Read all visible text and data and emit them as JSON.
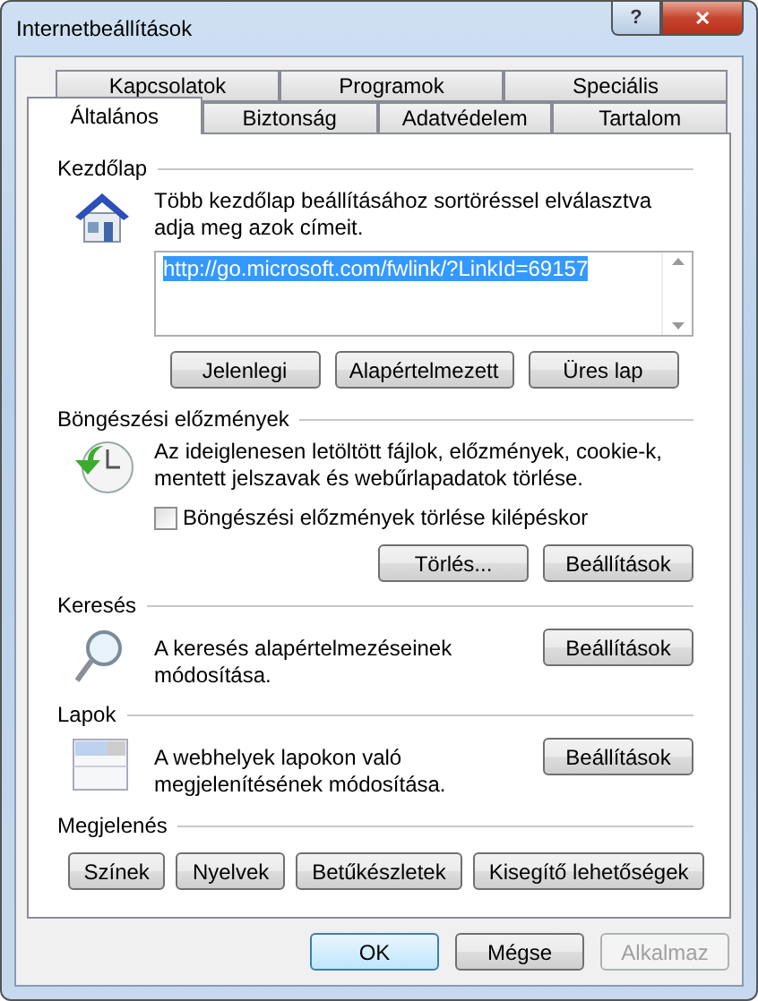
{
  "window": {
    "title": "Internetbeállítások",
    "help": "?",
    "close": "✕"
  },
  "tab_rows": [
    [
      {
        "label": "Kapcsolatok",
        "selected": false
      },
      {
        "label": "Programok",
        "selected": false
      },
      {
        "label": "Speciális",
        "selected": false
      }
    ],
    [
      {
        "label": "Általános",
        "selected": true
      },
      {
        "label": "Biztonság",
        "selected": false
      },
      {
        "label": "Adatvédelem",
        "selected": false
      },
      {
        "label": "Tartalom",
        "selected": false
      }
    ]
  ],
  "home": {
    "title": "Kezdőlap",
    "description": "Több kezdőlap beállításához sortöréssel elválasztva adja meg azok címeit.",
    "url": "http://go.microsoft.com/fwlink/?LinkId=69157",
    "buttons": [
      "Jelenlegi",
      "Alapértelmezett",
      "Üres lap"
    ]
  },
  "history": {
    "title": "Böngészési előzmények",
    "description": "Az ideiglenesen letöltött fájlok, előzmények, cookie-k, mentett jelszavak és webűrlapadatok törlése.",
    "checkbox": {
      "label": "Böngészési előzmények törlése kilépéskor",
      "checked": false
    },
    "buttons": [
      "Törlés...",
      "Beállítások"
    ]
  },
  "search": {
    "title": "Keresés",
    "description": "A keresés alapértelmezéseinek módosítása.",
    "button": "Beállítások"
  },
  "tabs": {
    "title": "Lapok",
    "description": "A webhelyek lapokon való megjelenítésének módosítása.",
    "button": "Beállítások"
  },
  "appearance": {
    "title": "Megjelenés",
    "buttons": [
      "Színek",
      "Nyelvek",
      "Betűkészletek",
      "Kisegítő lehetőségek"
    ]
  },
  "footer": [
    {
      "label": "OK",
      "default": true,
      "disabled": false
    },
    {
      "label": "Mégse",
      "default": false,
      "disabled": false
    },
    {
      "label": "Alkalmaz",
      "default": false,
      "disabled": true
    }
  ]
}
